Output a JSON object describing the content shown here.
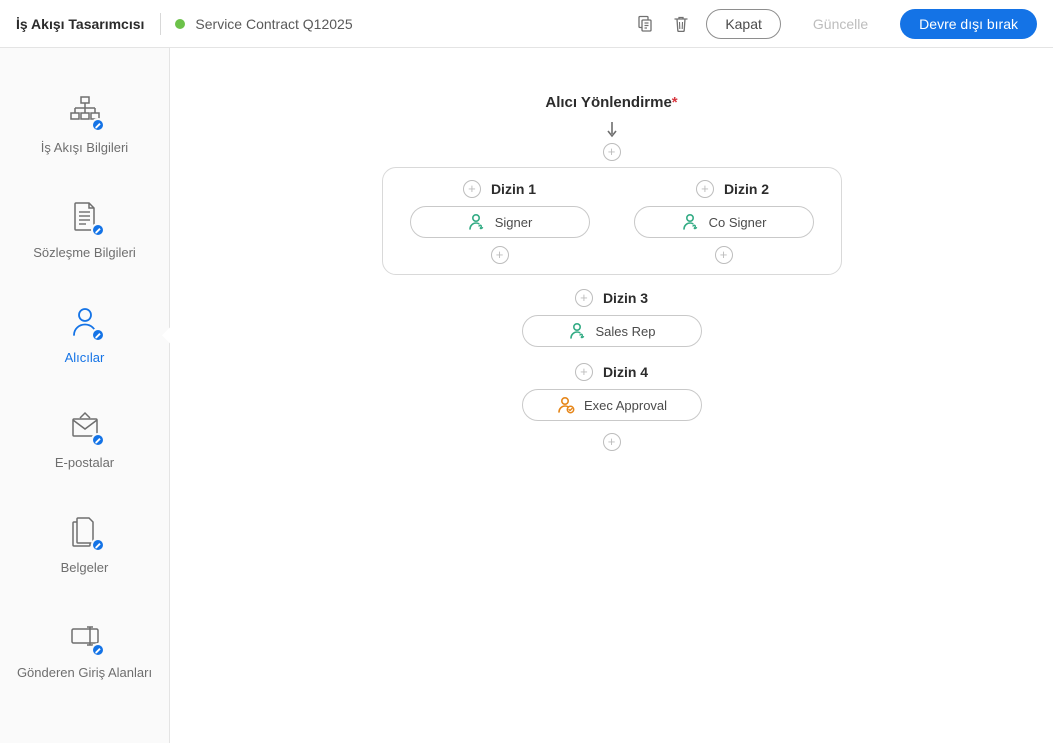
{
  "header": {
    "app_title": "İş Akışı Tasarımcısı",
    "workflow_name": "Service Contract Q12025",
    "close_label": "Kapat",
    "update_label": "Güncelle",
    "disable_label": "Devre dışı bırak",
    "status": "active",
    "status_color": "#6cc24a"
  },
  "sidebar": {
    "items": [
      {
        "label": "İş Akışı Bilgileri",
        "key": "workflow-info"
      },
      {
        "label": "Sözleşme Bilgileri",
        "key": "agreement-info"
      },
      {
        "label": "Alıcılar",
        "key": "recipients",
        "active": true
      },
      {
        "label": "E-postalar",
        "key": "emails"
      },
      {
        "label": "Belgeler",
        "key": "documents"
      },
      {
        "label": "Gönderen Giriş Alanları",
        "key": "sender-fields"
      }
    ]
  },
  "routing": {
    "title": "Alıcı Yönlendirme",
    "required": true,
    "parallel": {
      "branches": [
        {
          "title": "Dizin 1",
          "recipient": {
            "role": "signer",
            "label": "Signer"
          }
        },
        {
          "title": "Dizin 2",
          "recipient": {
            "role": "signer",
            "label": "Co Signer"
          }
        }
      ]
    },
    "serial": [
      {
        "title": "Dizin 3",
        "recipient": {
          "role": "signer",
          "label": "Sales Rep"
        }
      },
      {
        "title": "Dizin 4",
        "recipient": {
          "role": "approver",
          "label": "Exec Approval"
        }
      }
    ]
  },
  "colors": {
    "primary": "#1473e6",
    "signer_icon": "#33ab84",
    "approver_icon": "#e68619"
  }
}
